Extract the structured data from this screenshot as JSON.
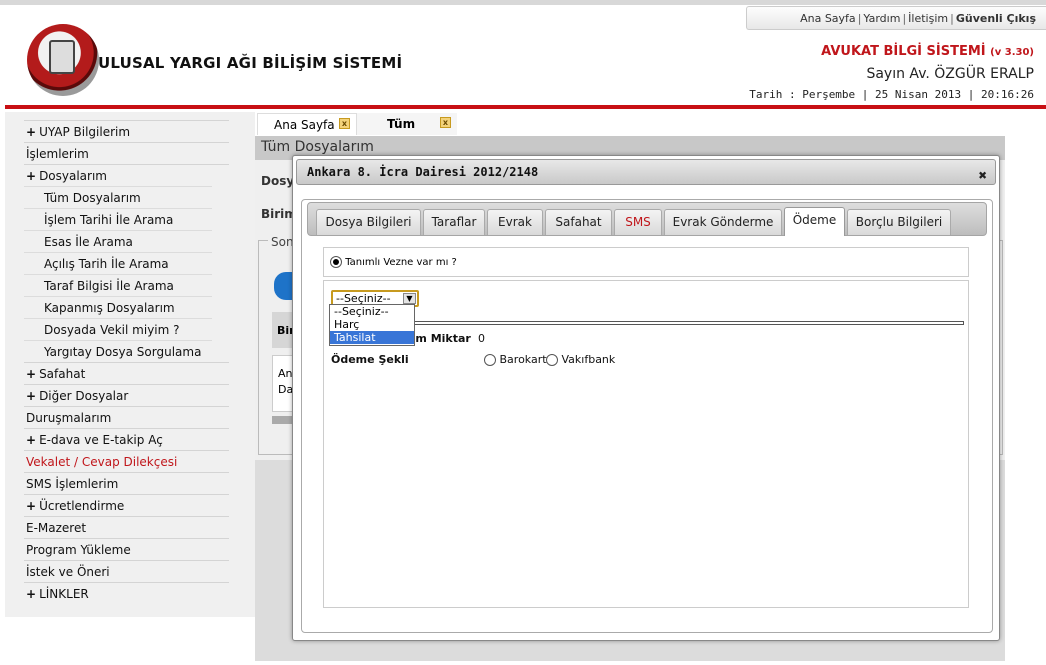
{
  "top_links": {
    "home": "Ana Sayfa",
    "help": "Yardım",
    "contact": "İletişim",
    "logout": "Güvenli Çıkış"
  },
  "header": {
    "app_title": "ULUSAL YARGI AĞI BİLİŞİM SİSTEMİ",
    "product_title": "AVUKAT BİLGİ SİSTEMİ",
    "product_version": "(v 3.30)",
    "user": "Sayın Av. ÖZGÜR ERALP",
    "date_line": "Tarih : Perşembe | 25 Nisan 2013 | 20:16:26"
  },
  "sidebar": {
    "items": [
      {
        "label": "UYAP Bilgilerim",
        "expand": "+"
      },
      {
        "label": "İşlemlerim",
        "expand": ""
      },
      {
        "label": "Dosyalarım",
        "expand": "+"
      },
      {
        "label": "Tüm Dosyalarım",
        "expand": ""
      },
      {
        "label": "İşlem Tarihi İle Arama",
        "expand": ""
      },
      {
        "label": "Esas İle Arama",
        "expand": ""
      },
      {
        "label": "Açılış Tarih İle Arama",
        "expand": ""
      },
      {
        "label": "Taraf Bilgisi İle Arama",
        "expand": ""
      },
      {
        "label": "Kapanmış Dosyalarım",
        "expand": ""
      },
      {
        "label": "Dosyada Vekil miyim ?",
        "expand": ""
      },
      {
        "label": "Yargıtay Dosya Sorgulama",
        "expand": ""
      },
      {
        "label": "Safahat",
        "expand": "+"
      },
      {
        "label": "Diğer Dosyalar",
        "expand": "+"
      },
      {
        "label": "Duruşmalarım",
        "expand": ""
      },
      {
        "label": "E-dava ve E-takip Aç",
        "expand": "+"
      },
      {
        "label": "Vekalet / Cevap Dilekçesi",
        "expand": ""
      },
      {
        "label": "SMS İşlemlerim",
        "expand": ""
      },
      {
        "label": "Ücretlendirme",
        "expand": "+"
      },
      {
        "label": "E-Mazeret",
        "expand": ""
      },
      {
        "label": "Program Yükleme",
        "expand": ""
      },
      {
        "label": "İstek ve Öneri",
        "expand": ""
      },
      {
        "label": "LİNKLER",
        "expand": "+"
      }
    ]
  },
  "main_tabs": [
    {
      "label": "Ana Sayfa"
    },
    {
      "label": "Tüm"
    }
  ],
  "background": {
    "page_title": "Tüm Dosyalarım",
    "label_dosya": "Dosya",
    "label_birim": "Birim",
    "legend": "Son",
    "box_label": "Bir",
    "box2_line1": "An",
    "box2_line2": "Da"
  },
  "modal": {
    "title": "Ankara 8. İcra Dairesi 2012/2148",
    "close": "✖",
    "tabs": [
      {
        "label": "Dosya Bilgileri"
      },
      {
        "label": "Taraflar"
      },
      {
        "label": "Evrak"
      },
      {
        "label": "Safahat"
      },
      {
        "label": "SMS"
      },
      {
        "label": "Evrak Gönderme"
      },
      {
        "label": "Ödeme"
      },
      {
        "label": "Borçlu Bilgileri"
      }
    ],
    "active_tab": "Ödeme",
    "vezne_label": "Tanımlı Vezne var mı ?",
    "select_value": "--Seçiniz--",
    "select_options": [
      "--Seçiniz--",
      "Harç",
      "Tahsilat"
    ],
    "highlighted_option": "Tahsilat",
    "amount_label": "Toplam Miktar",
    "amount_label_visible": "am Miktar",
    "amount_value": "0",
    "payment_label": "Ödeme Şekli",
    "payment_options": [
      "Barokart",
      "Vakıfbank"
    ]
  },
  "colors": {
    "brand_red": "#c80f14",
    "accent_gold": "#c79a1f",
    "highlight_blue": "#3875d7"
  }
}
